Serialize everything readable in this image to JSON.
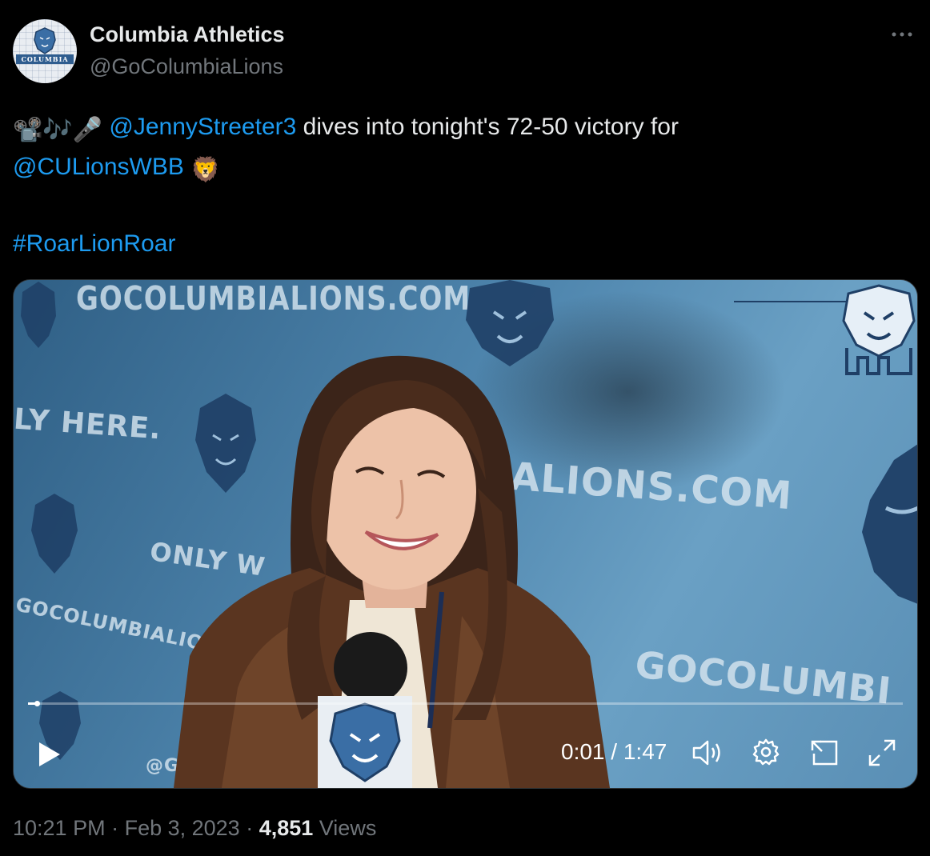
{
  "author": {
    "name": "Columbia Athletics",
    "handle": "@GoColumbiaLions",
    "avatar_text": "COLUMBIA"
  },
  "tweet": {
    "emojis": "📽️🎶🎤",
    "mention_1": "@JennyStreeter3",
    "text_1": " dives into tonight's 72-50 victory for",
    "mention_2": "@CULionsWBB",
    "lion_emoji": "🦁",
    "hashtag": "#RoarLionRoar"
  },
  "video": {
    "backdrop_texts": {
      "top": "GOCOLUMBIALIONS.COM",
      "here": "LY HERE.",
      "middle": "ALIONS.COM",
      "only": "ONLY W",
      "diag": "GOCOLUMBIALIONS",
      "bottom": "GOCOLUMBI",
      "corner": "@GO"
    },
    "time_current": "0:01",
    "time_separator": " / ",
    "time_total": "1:47",
    "progress": 0.01
  },
  "meta": {
    "time": "10:21 PM",
    "sep": " · ",
    "date": "Feb 3, 2023",
    "views_count": "4,851",
    "views_label": " Views"
  },
  "icons": {
    "more": "more-icon",
    "play": "play-icon",
    "volume": "volume-icon",
    "settings": "gear-icon",
    "pip": "pip-icon",
    "fullscreen": "fullscreen-icon"
  }
}
